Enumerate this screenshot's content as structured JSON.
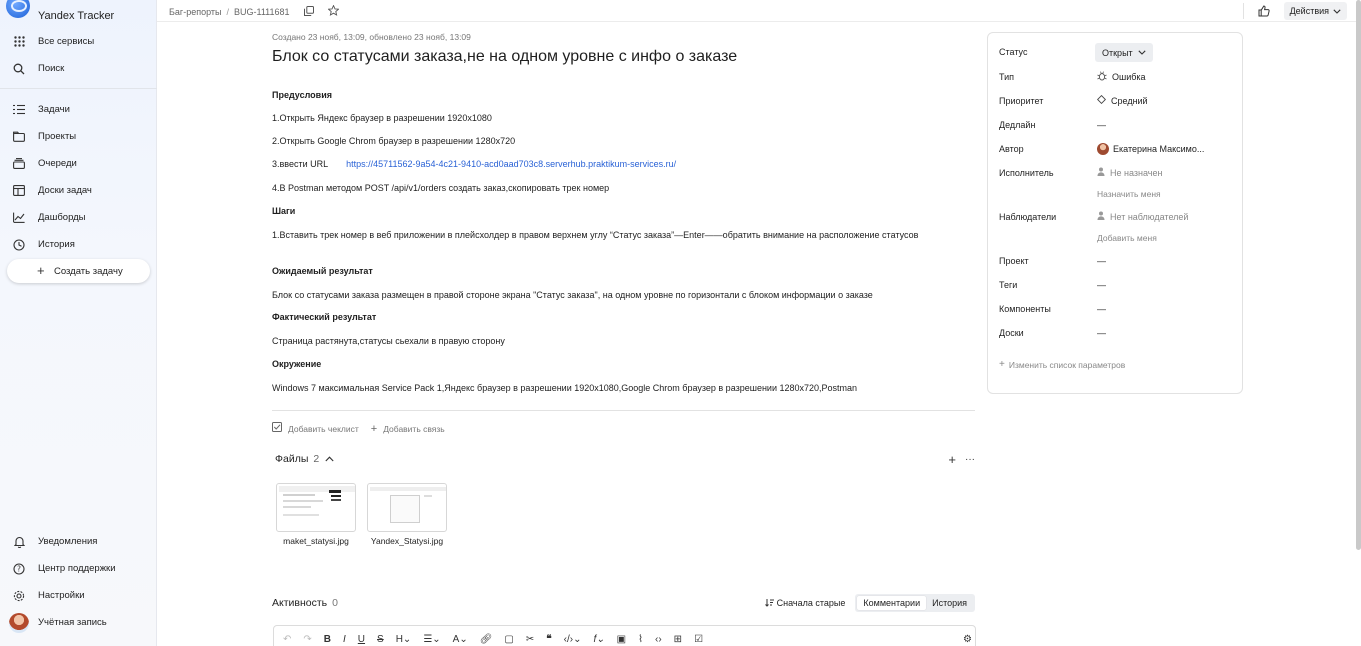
{
  "app": {
    "name": "Yandex Tracker"
  },
  "sidebar": {
    "items_top": [
      {
        "label": "Все сервисы",
        "icon": "grid-icon"
      },
      {
        "label": "Поиск",
        "icon": "search-icon"
      }
    ],
    "items_main": [
      {
        "label": "Задачи",
        "icon": "tasks-icon"
      },
      {
        "label": "Проекты",
        "icon": "projects-icon"
      },
      {
        "label": "Очереди",
        "icon": "queues-icon"
      },
      {
        "label": "Доски задач",
        "icon": "boards-icon"
      },
      {
        "label": "Дашборды",
        "icon": "dashboards-icon"
      },
      {
        "label": "История",
        "icon": "history-icon"
      }
    ],
    "create_task": "Создать задачу",
    "items_bottom": [
      {
        "label": "Уведомления",
        "icon": "bell-icon"
      },
      {
        "label": "Центр поддержки",
        "icon": "help-icon"
      },
      {
        "label": "Настройки",
        "icon": "gear-icon"
      },
      {
        "label": "Учётная запись",
        "icon": "avatar"
      }
    ]
  },
  "topbar": {
    "breadcrumb_queue": "Баг-репорты",
    "breadcrumb_sep": "/",
    "issue_key": "BUG-1111681",
    "actions_label": "Действия"
  },
  "issue": {
    "meta": "Создано 23 нояб, 13:09, обновлено 23 нояб, 13:09",
    "title": "Блок со статусами заказа,не на одном уровне с инфо о заказе",
    "sections": {
      "preconditions_title": "Предусловия",
      "pre1": "1.Открыть Яндекс браузер в разрешении 1920x1080",
      "pre2": "2.Открыть Google Chrom браузер в разрешении 1280x720",
      "pre3": "3.ввести URL",
      "pre3_link": "https://45711562-9a54-4c21-9410-acd0aad703c8.serverhub.praktikum-services.ru/",
      "pre4": "4.В Postman методом POST /api/v1/orders создать заказ,скопировать трек номер",
      "steps_title": "Шаги",
      "step1": "1.Вставить трек номер в веб приложении в плейсхолдер в правом верхнем углу “Статус заказа”—Enter——обратить внимание на расположение статусов",
      "expected_title": "Ожидаемый результат",
      "expected": "Блок со статусами заказа размещен в правой стороне экрана \"Статус заказа\", на одном уровне по горизонтали с блоком информации о заказе",
      "actual_title": "Фактический результат",
      "actual": "Страница растянута,статусы сьехали в правую сторону",
      "env_title": "Окружение",
      "env": "Windows 7 максимальная Service Pack 1,Яндекс браузер в разрешении 1920x1080,Google Chrom браузер в разрешении 1280x720,Postman"
    },
    "add_checklist": "Добавить чеклист",
    "add_link": "Добавить связь",
    "files_title": "Файлы",
    "files_count": "2",
    "files": [
      {
        "name": "maket_statysi.jpg"
      },
      {
        "name": "Yandex_Statysi.jpg"
      }
    ],
    "activity_title": "Активность",
    "activity_count": "0",
    "sort_label": "Сначала старые",
    "tab_comments": "Комментарии",
    "tab_history": "История"
  },
  "panel": {
    "status_label": "Статус",
    "status_value": "Открыт",
    "type_label": "Тип",
    "type_value": "Ошибка",
    "priority_label": "Приоритет",
    "priority_value": "Средний",
    "deadline_label": "Дедлайн",
    "deadline_value": "—",
    "author_label": "Автор",
    "author_value": "Екатерина Максимо...",
    "assignee_label": "Исполнитель",
    "assignee_value": "Не назначен",
    "assign_me": "Назначить меня",
    "followers_label": "Наблюдатели",
    "followers_value": "Нет наблюдателей",
    "add_me": "Добавить меня",
    "project_label": "Проект",
    "project_value": "—",
    "tags_label": "Теги",
    "tags_value": "—",
    "components_label": "Компоненты",
    "components_value": "—",
    "boards_label": "Доски",
    "boards_value": "—",
    "change_params": "Изменить список параметров"
  }
}
